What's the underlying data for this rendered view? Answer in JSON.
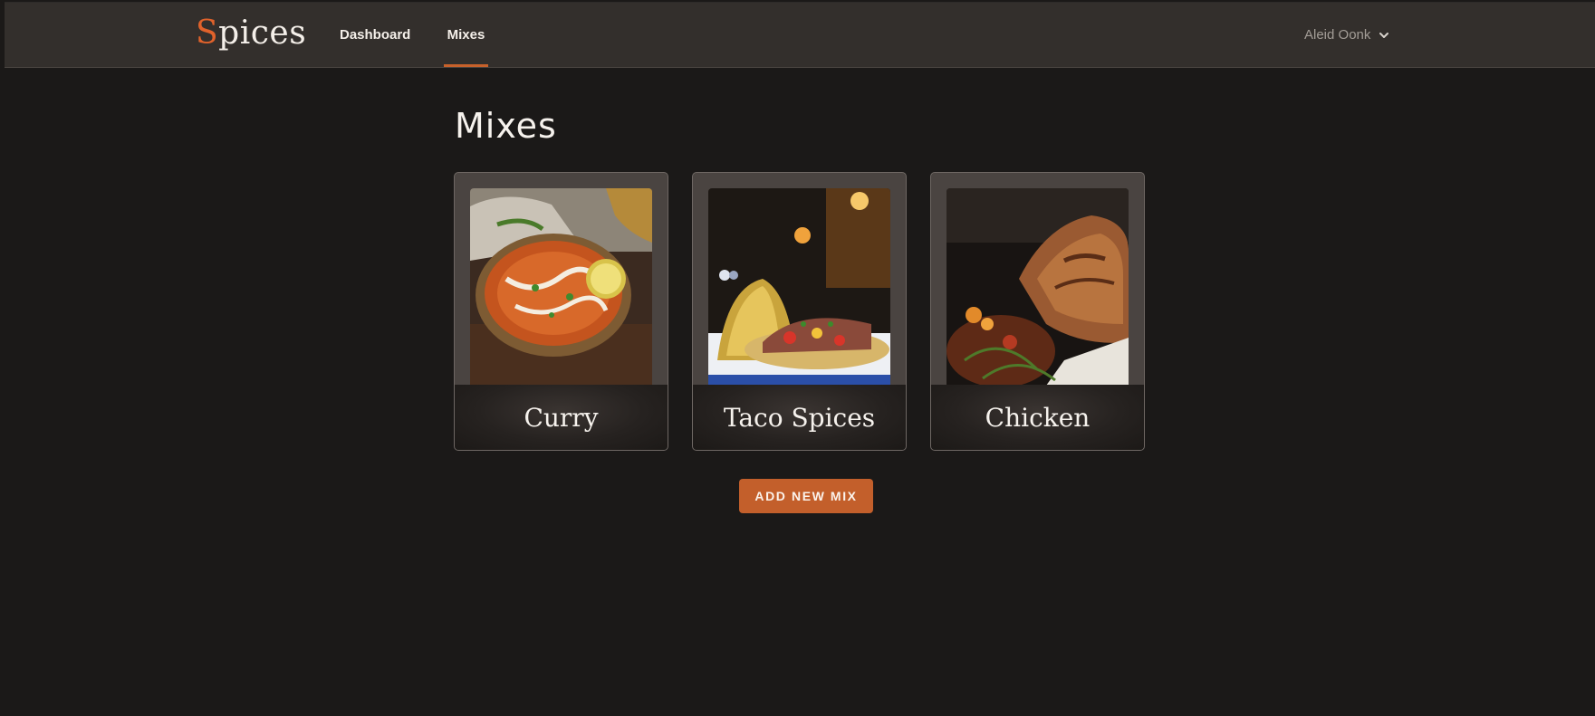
{
  "header": {
    "logo_first": "S",
    "logo_rest": "pices",
    "nav": [
      {
        "label": "Dashboard",
        "active": false
      },
      {
        "label": "Mixes",
        "active": true
      }
    ],
    "user_name": "Aleid Oonk",
    "user_menu_icon": "chevron-down-icon"
  },
  "main": {
    "title": "Mixes",
    "cards": [
      {
        "label": "Curry",
        "image": "curry-photo"
      },
      {
        "label": "Taco Spices",
        "image": "taco-photo"
      },
      {
        "label": "Chicken",
        "image": "chicken-photo"
      }
    ],
    "add_button": "ADD NEW MIX"
  },
  "colors": {
    "accent": "#c35f2b",
    "header_bg": "#332f2c",
    "page_bg": "#1b1918",
    "card_bg": "#4a4441"
  }
}
